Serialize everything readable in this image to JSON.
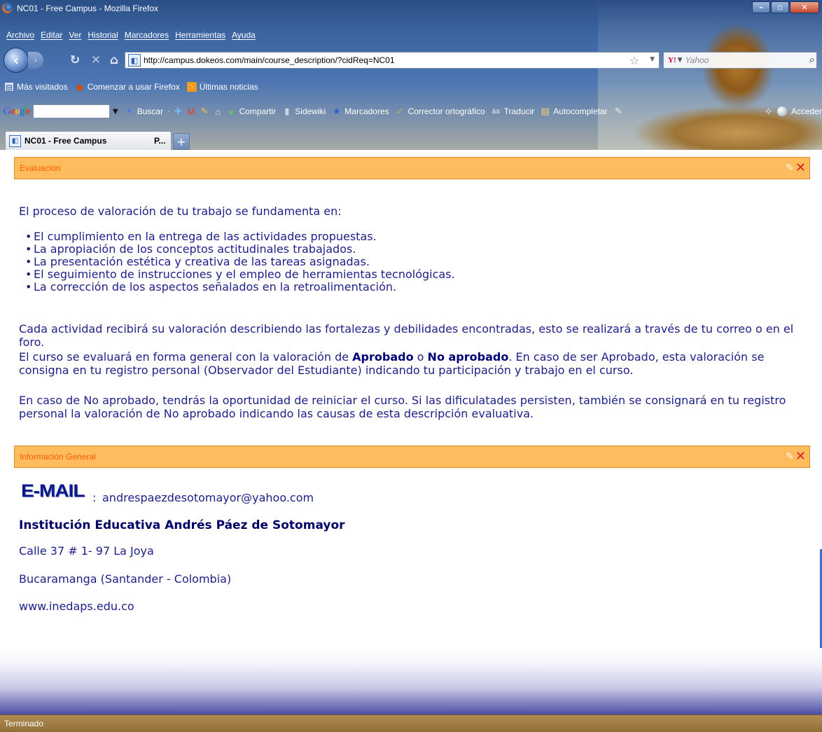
{
  "window": {
    "title": "NC01 - Free Campus - Mozilla Firefox"
  },
  "menu": [
    "Archivo",
    "Editar",
    "Ver",
    "Historial",
    "Marcadores",
    "Herramientas",
    "Ayuda"
  ],
  "nav": {
    "url": "http://campus.dokeos.com/main/course_description/?cidReq=NC01",
    "search_placeholder": "Yahoo",
    "search_engine_label": "Y!"
  },
  "bookmarks": [
    "Más visitados",
    "Comenzar a usar Firefox",
    "Últimas noticias"
  ],
  "google_toolbar": {
    "logo": "Google",
    "buscar": "Buscar",
    "compartir": "Compartir",
    "sidewiki": "Sidewiki",
    "marcadores": "Marcadores",
    "corrector": "Corrector ortográfico",
    "traducir": "Traducir",
    "autocompletar": "Autocompletar",
    "acceder": "Acceder"
  },
  "tab": {
    "label": "NC01 - Free Campus",
    "label_truncated": "P..."
  },
  "sections": {
    "evaluacion": {
      "title": "Evaluación",
      "intro": "El proceso de valoración de tu trabajo se fundamenta en:",
      "items": [
        "El cumplimiento en la entrega de las actividades propuestas.",
        "La apropiación de los conceptos actitudinales trabajados.",
        "La presentación estética y creativa de las tareas asignadas.",
        "El seguimiento de instrucciones y el empleo de herramientas tecnológicas.",
        "La corrección de los aspectos señalados en la retroalimentación."
      ],
      "p1": "Cada actividad recibirá su valoración describiendo las fortalezas y debilidades encontradas, esto se realizará a través de tu correo o en el foro.",
      "p2_a": "El curso se evaluará en forma general con la valoración de ",
      "p2_bold1": "Aprobado",
      "p2_b": " o ",
      "p2_bold2": "No aprobado",
      "p2_c": ". En caso de ser Aprobado, esta valoración se consigna en tu registro personal (Observador del Estudiante) indicando tu participación y trabajo en el curso.",
      "p3": "En caso de No aprobado, tendrás la oportunidad de reiniciar el curso. Si las dificulatades persisten, también se consignará en tu registro personal la valoración de No aprobado indicando las causas de esta descripción evaluativa."
    },
    "info": {
      "title": "Información General",
      "institution": "Institución Educativa Andrés Páez de Sotomayor",
      "address": "Calle 37 # 1- 97 La Joya",
      "city": "Bucaramanga (Santander - Colombia)",
      "website": "www.inedaps.edu.co",
      "email_logo": "E-MAIL",
      "email_colon": ":",
      "email": "andrespaezdesotomayor@yahoo.com"
    }
  },
  "status": "Terminado"
}
